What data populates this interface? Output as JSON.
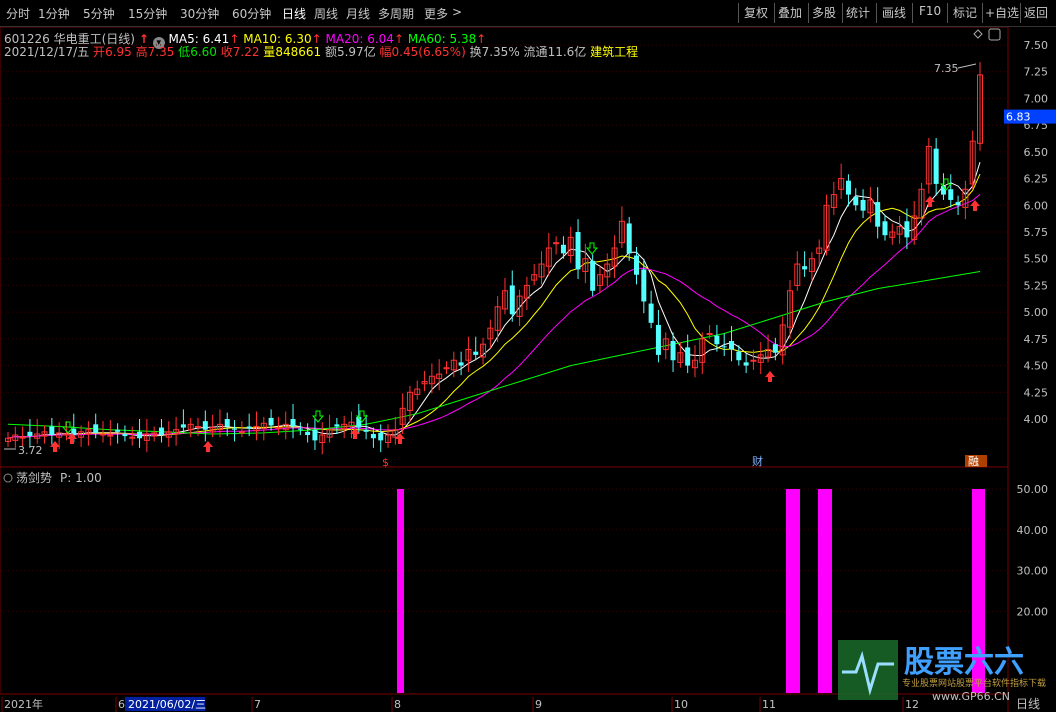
{
  "toolbar": {
    "periods": [
      "分时",
      "1分钟",
      "5分钟",
      "15分钟",
      "30分钟",
      "60分钟",
      "日线",
      "周线",
      "月线",
      "多周期",
      "更多"
    ],
    "active_period": "日线",
    "more_arrow": ">",
    "right": [
      "复权",
      "叠加",
      "多股",
      "统计",
      "画线",
      "F10",
      "标记",
      "+自选",
      "返回"
    ]
  },
  "stock": {
    "code_name": "601226 华电重工",
    "period_label": "(日线)",
    "date": "2021/12/17/五",
    "open_label": "开",
    "open": "6.95",
    "high_label": "高",
    "high": "7.35",
    "low_label": "低",
    "low": "6.60",
    "close_label": "收",
    "close": "7.22",
    "volume_label": "量",
    "volume": "848661",
    "amount_label": "额",
    "amount": "5.97亿",
    "range_label": "幅",
    "range": "0.45(6.65%)",
    "turnover_label": "换",
    "turnover": "7.35%",
    "float_label": "流通",
    "float": "11.6亿",
    "industry": "建筑工程",
    "ma5_label": "MA5: 6.41",
    "ma10_label": "MA10: 6.30",
    "ma20_label": "MA20: 6.04",
    "ma60_label": "MA60: 5.38",
    "current_price_box": "6.83",
    "high_marker": "7.35",
    "low_marker": "3.72",
    "event_s": "$",
    "event_cai": "财",
    "event_rong": "融"
  },
  "colors": {
    "up": "#ff3232",
    "down": "#54ffff",
    "ma5": "#ffffff",
    "ma10": "#ffff00",
    "ma20": "#ff00ff",
    "ma60": "#00ff00",
    "indicator": "#ff00ff",
    "grid": "#3a0000",
    "axis_text": "#c0c0c0"
  },
  "indicator": {
    "name": "荡剑势",
    "param": "P: 1.00",
    "ticks": [
      "50.00",
      "40.00",
      "30.00",
      "20.00"
    ],
    "bars_value": 50
  },
  "price_axis": {
    "ticks": [
      "7.50",
      "7.25",
      "7.00",
      "6.75",
      "6.50",
      "6.25",
      "6.00",
      "5.75",
      "5.50",
      "5.25",
      "5.00",
      "4.75",
      "4.50",
      "4.25",
      "4.00"
    ]
  },
  "date_axis": {
    "labels": [
      "2021年",
      "6",
      "2021/06/02/三",
      "7",
      "8",
      "9",
      "10",
      "11",
      "12"
    ],
    "period_tab": "日线"
  },
  "watermark": {
    "brand": "股票六六",
    "sub": "专业股票网站股票平台软件指标下载",
    "url": "www.GP66.CN"
  },
  "chart_data": {
    "type": "candlestick",
    "y_range": [
      3.6,
      7.6
    ],
    "x_labels": [
      "2021年",
      "6",
      "7",
      "8",
      "9",
      "10",
      "11",
      "12"
    ],
    "ohlc_approx_close": [
      3.82,
      3.85,
      3.83,
      3.84,
      3.86,
      3.88,
      3.85,
      3.87,
      3.86,
      3.85,
      3.88,
      3.9,
      3.87,
      3.86,
      3.85,
      3.88,
      3.84,
      3.83,
      3.82,
      3.86,
      3.87,
      3.85,
      3.88,
      3.9,
      3.92,
      3.95,
      3.93,
      3.9,
      3.92,
      3.95,
      3.93,
      3.9,
      3.88,
      3.91,
      3.93,
      3.96,
      3.94,
      3.92,
      3.95,
      3.93,
      3.9,
      3.85,
      3.8,
      3.85,
      3.9,
      3.93,
      3.95,
      3.97,
      3.92,
      3.88,
      3.82,
      3.8,
      3.85,
      3.9,
      4.1,
      4.25,
      4.28,
      4.35,
      4.4,
      4.42,
      4.48,
      4.55,
      4.5,
      4.65,
      4.6,
      4.7,
      4.85,
      5.05,
      5.2,
      4.98,
      5.15,
      5.25,
      5.35,
      5.45,
      5.6,
      5.65,
      5.55,
      5.7,
      5.4,
      5.5,
      5.2,
      5.35,
      5.45,
      5.6,
      5.85,
      5.55,
      5.35,
      5.1,
      4.9,
      4.6,
      4.75,
      4.55,
      4.62,
      4.5,
      4.55,
      4.75,
      4.8,
      4.7,
      4.68,
      4.65,
      4.55,
      4.5,
      4.55,
      4.6,
      4.65,
      4.62,
      4.88,
      5.2,
      5.45,
      5.4,
      5.5,
      5.6,
      6.0,
      6.1,
      6.25,
      6.1,
      6.0,
      5.95,
      6.05,
      5.8,
      5.72,
      5.75,
      5.8,
      5.7,
      5.9,
      6.15,
      6.55,
      6.2,
      6.1,
      6.05,
      6.0,
      6.15,
      6.6,
      7.22
    ],
    "ma60_approx": [
      3.95,
      3.93,
      3.9,
      3.88,
      3.86,
      3.87,
      3.9,
      3.95,
      4.05,
      4.2,
      4.35,
      4.5,
      4.6,
      4.7,
      4.8,
      4.95,
      5.1,
      5.22,
      5.3,
      5.38
    ],
    "indicator_bars": [
      {
        "label": "8月初",
        "value": 50
      },
      {
        "label": "11月初",
        "value": 50
      },
      {
        "label": "11月中",
        "value": 50
      },
      {
        "label": "12月中",
        "value": 50
      }
    ]
  }
}
